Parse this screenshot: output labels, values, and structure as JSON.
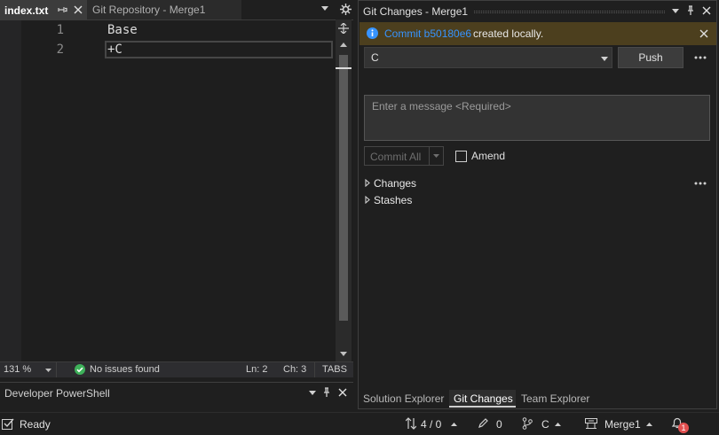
{
  "tabs": {
    "active": "index.txt",
    "inactive": "Git Repository - Merge1"
  },
  "editor": {
    "lines": [
      {
        "number": "1",
        "text": "Base"
      },
      {
        "number": "2",
        "text": "+C"
      }
    ],
    "status": {
      "zoom": "131 %",
      "issues": "No issues found",
      "line": "Ln: 2",
      "char": "Ch: 3",
      "indent": "TABS"
    }
  },
  "terminal": {
    "title": "Developer PowerShell"
  },
  "git_changes": {
    "title": "Git Changes - Merge1",
    "banner": {
      "commit_link": "Commit b50180e6",
      "suffix": "created locally."
    },
    "branch": "C",
    "push_label": "Push",
    "message_placeholder": "Enter a message <Required>",
    "commit_all_label": "Commit All",
    "amend_label": "Amend",
    "changes_label": "Changes",
    "stashes_label": "Stashes"
  },
  "bottom_tabs": [
    "Solution Explorer",
    "Git Changes",
    "Team Explorer"
  ],
  "statusbar": {
    "ready": "Ready",
    "sync": "4 / 0",
    "edits": "0",
    "branch": "C",
    "repo": "Merge1",
    "notifications": "1"
  },
  "colors": {
    "info_blue": "#3794ff",
    "success_green": "#3eb15a",
    "notification_red": "#e25050",
    "banner_bg": "#4c3f1e"
  }
}
